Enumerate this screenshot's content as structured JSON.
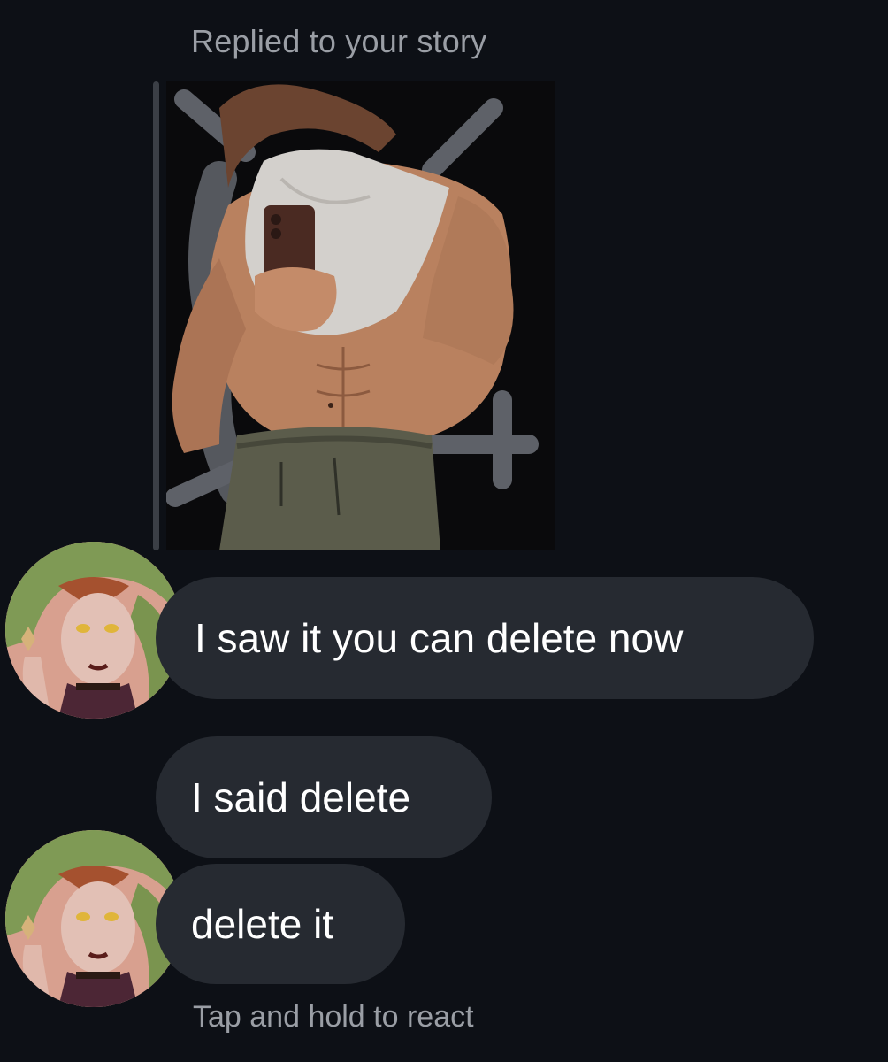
{
  "story_reply": {
    "header": "Replied to your story",
    "thumbnail_icon": "story-thumbnail-image"
  },
  "messages": [
    {
      "sender": "them",
      "text": "I saw it you can delete now",
      "show_avatar": true
    },
    {
      "sender": "them",
      "text": "I said delete",
      "show_avatar": false
    },
    {
      "sender": "them",
      "text": "delete it",
      "show_avatar": true
    }
  ],
  "footer_hint": "Tap and hold to react",
  "colors": {
    "background": "#0d1016",
    "bubble": "#262a31",
    "muted_text": "#9a9ea5",
    "reply_bar": "#3b3f46"
  }
}
